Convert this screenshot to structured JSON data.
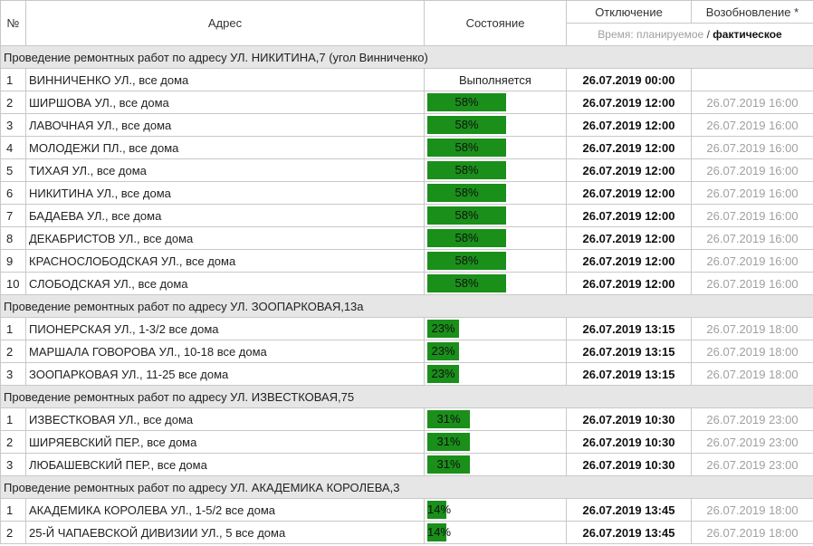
{
  "header": {
    "num": "№",
    "address": "Адрес",
    "state": "Состояние",
    "off": "Отключение",
    "restore": "Возобновление *",
    "time_prefix": "Время:",
    "planned": "планируемое",
    "slash": "/",
    "actual": "фактическое"
  },
  "colors": {
    "progress": "#1a8f1a",
    "group_bg": "#e6e6e6",
    "muted_text": "#a0a0a0"
  },
  "groups": [
    {
      "title": "Проведение ремонтных работ по адресу УЛ. НИКИТИНА,7 (угол Винниченко)",
      "rows": [
        {
          "n": "1",
          "address": "ВИННИЧЕНКО УЛ., все дома",
          "status": "Выполняется",
          "off": "26.07.2019 00:00",
          "on": ""
        },
        {
          "n": "2",
          "address": "ШИРШОВА УЛ., все дома",
          "progress": "58%",
          "off": "26.07.2019 12:00",
          "on": "26.07.2019 16:00"
        },
        {
          "n": "3",
          "address": "ЛАВОЧНАЯ УЛ., все дома",
          "progress": "58%",
          "off": "26.07.2019 12:00",
          "on": "26.07.2019 16:00"
        },
        {
          "n": "4",
          "address": "МОЛОДЕЖИ ПЛ., все дома",
          "progress": "58%",
          "off": "26.07.2019 12:00",
          "on": "26.07.2019 16:00"
        },
        {
          "n": "5",
          "address": "ТИХАЯ УЛ., все дома",
          "progress": "58%",
          "off": "26.07.2019 12:00",
          "on": "26.07.2019 16:00"
        },
        {
          "n": "6",
          "address": "НИКИТИНА УЛ., все дома",
          "progress": "58%",
          "off": "26.07.2019 12:00",
          "on": "26.07.2019 16:00"
        },
        {
          "n": "7",
          "address": "БАДАЕВА УЛ., все дома",
          "progress": "58%",
          "off": "26.07.2019 12:00",
          "on": "26.07.2019 16:00"
        },
        {
          "n": "8",
          "address": "ДЕКАБРИСТОВ УЛ., все дома",
          "progress": "58%",
          "off": "26.07.2019 12:00",
          "on": "26.07.2019 16:00"
        },
        {
          "n": "9",
          "address": "КРАСНОСЛОБОДСКАЯ УЛ., все дома",
          "progress": "58%",
          "off": "26.07.2019 12:00",
          "on": "26.07.2019 16:00"
        },
        {
          "n": "10",
          "address": "СЛОБОДСКАЯ УЛ., все дома",
          "progress": "58%",
          "off": "26.07.2019 12:00",
          "on": "26.07.2019 16:00"
        }
      ]
    },
    {
      "title": "Проведение ремонтных работ по адресу УЛ. ЗООПАРКОВАЯ,13а",
      "rows": [
        {
          "n": "1",
          "address": "ПИОНЕРСКАЯ УЛ., 1-3/2 все дома",
          "progress": "23%",
          "off": "26.07.2019 13:15",
          "on": "26.07.2019 18:00"
        },
        {
          "n": "2",
          "address": "МАРШАЛА ГОВОРОВА УЛ., 10-18 все дома",
          "progress": "23%",
          "off": "26.07.2019 13:15",
          "on": "26.07.2019 18:00"
        },
        {
          "n": "3",
          "address": "ЗООПАРКОВАЯ УЛ., 11-25 все дома",
          "progress": "23%",
          "off": "26.07.2019 13:15",
          "on": "26.07.2019 18:00"
        }
      ]
    },
    {
      "title": "Проведение ремонтных работ по адресу УЛ. ИЗВЕСТКОВАЯ,75",
      "rows": [
        {
          "n": "1",
          "address": "ИЗВЕСТКОВАЯ УЛ., все дома",
          "progress": "31%",
          "off": "26.07.2019 10:30",
          "on": "26.07.2019 23:00"
        },
        {
          "n": "2",
          "address": "ШИРЯЕВСКИЙ ПЕР., все дома",
          "progress": "31%",
          "off": "26.07.2019 10:30",
          "on": "26.07.2019 23:00"
        },
        {
          "n": "3",
          "address": "ЛЮБАШЕВСКИЙ ПЕР., все дома",
          "progress": "31%",
          "off": "26.07.2019 10:30",
          "on": "26.07.2019 23:00"
        }
      ]
    },
    {
      "title": "Проведение ремонтных работ по адресу УЛ. АКАДЕМИКА КОРОЛЕВА,3",
      "rows": [
        {
          "n": "1",
          "address": "АКАДЕМИКА КОРОЛЕВА УЛ., 1-5/2 все дома",
          "progress": "14%",
          "off": "26.07.2019 13:45",
          "on": "26.07.2019 18:00"
        },
        {
          "n": "2",
          "address": "25-Й ЧАПАЕВСКОЙ ДИВИЗИИ УЛ., 5 все дома",
          "progress": "14%",
          "off": "26.07.2019 13:45",
          "on": "26.07.2019 18:00"
        }
      ]
    }
  ]
}
